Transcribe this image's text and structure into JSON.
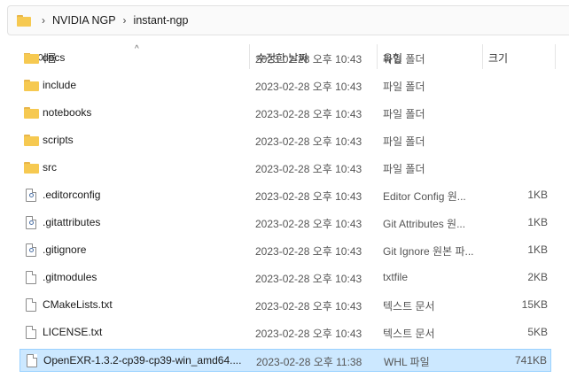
{
  "breadcrumb": [
    "NVIDIA NGP",
    "instant-ngp"
  ],
  "columns": {
    "name": "이름",
    "date": "수정한 날짜",
    "type": "유형",
    "size": "크기"
  },
  "rows": [
    {
      "name": "docs",
      "date": "2023-02-28 오후 10:43",
      "type": "파일 폴더",
      "size": "",
      "kind": "folder"
    },
    {
      "name": "include",
      "date": "2023-02-28 오후 10:43",
      "type": "파일 폴더",
      "size": "",
      "kind": "folder"
    },
    {
      "name": "notebooks",
      "date": "2023-02-28 오후 10:43",
      "type": "파일 폴더",
      "size": "",
      "kind": "folder"
    },
    {
      "name": "scripts",
      "date": "2023-02-28 오후 10:43",
      "type": "파일 폴더",
      "size": "",
      "kind": "folder"
    },
    {
      "name": "src",
      "date": "2023-02-28 오후 10:43",
      "type": "파일 폴더",
      "size": "",
      "kind": "folder"
    },
    {
      "name": ".editorconfig",
      "date": "2023-02-28 오후 10:43",
      "type": "Editor Config 원...",
      "size": "1KB",
      "kind": "config"
    },
    {
      "name": ".gitattributes",
      "date": "2023-02-28 오후 10:43",
      "type": "Git Attributes 원...",
      "size": "1KB",
      "kind": "config"
    },
    {
      "name": ".gitignore",
      "date": "2023-02-28 오후 10:43",
      "type": "Git Ignore 원본 파...",
      "size": "1KB",
      "kind": "config"
    },
    {
      "name": ".gitmodules",
      "date": "2023-02-28 오후 10:43",
      "type": "txtfile",
      "size": "2KB",
      "kind": "file"
    },
    {
      "name": "CMakeLists.txt",
      "date": "2023-02-28 오후 10:43",
      "type": "텍스트 문서",
      "size": "15KB",
      "kind": "text"
    },
    {
      "name": "LICENSE.txt",
      "date": "2023-02-28 오후 10:43",
      "type": "텍스트 문서",
      "size": "5KB",
      "kind": "text"
    },
    {
      "name": "OpenEXR-1.3.2-cp39-cp39-win_amd64....",
      "date": "2023-02-28 오후 11:38",
      "type": "WHL 파일",
      "size": "741KB",
      "kind": "file"
    }
  ],
  "selected_index": 11,
  "colors": {
    "folder": "#f6c951",
    "selection": "#cce8ff",
    "selection_border": "#99d1ff"
  }
}
